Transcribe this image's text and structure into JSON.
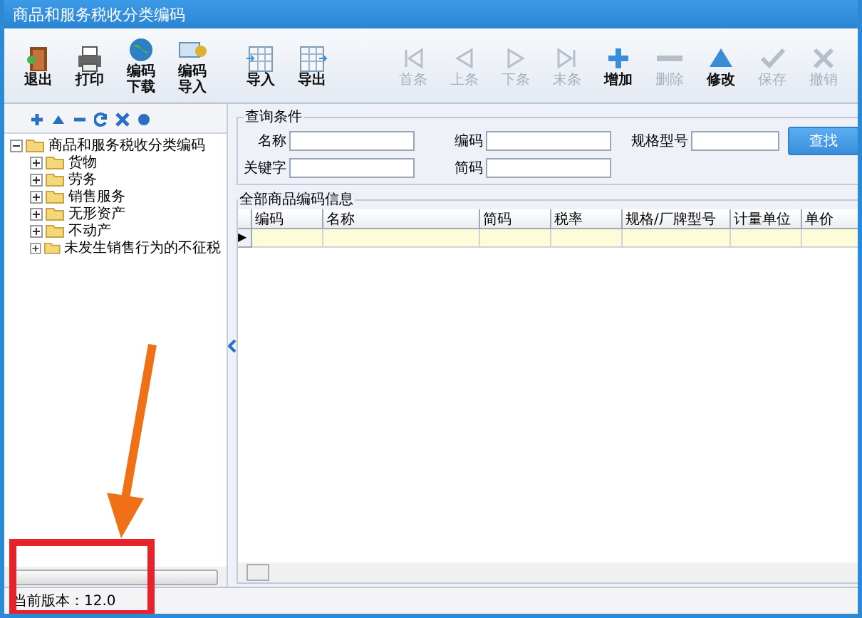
{
  "window": {
    "title": "商品和服务税收分类编码"
  },
  "toolbar_left": [
    {
      "label": "退出",
      "kind": "exit"
    },
    {
      "label": "打印",
      "kind": "print"
    },
    {
      "label": "编码下载",
      "kind": "download"
    },
    {
      "label": "编码导入",
      "kind": "import-code"
    },
    {
      "label": "导入",
      "kind": "import"
    },
    {
      "label": "导出",
      "kind": "export"
    }
  ],
  "toolbar_right": [
    {
      "label": "首条",
      "kind": "first",
      "disabled": true
    },
    {
      "label": "上条",
      "kind": "prev",
      "disabled": true
    },
    {
      "label": "下条",
      "kind": "next",
      "disabled": true
    },
    {
      "label": "末条",
      "kind": "last",
      "disabled": true
    },
    {
      "label": "增加",
      "kind": "add",
      "disabled": false
    },
    {
      "label": "删除",
      "kind": "delete",
      "disabled": true
    },
    {
      "label": "修改",
      "kind": "edit",
      "disabled": false
    },
    {
      "label": "保存",
      "kind": "save",
      "disabled": true
    },
    {
      "label": "撤销",
      "kind": "cancel",
      "disabled": true
    }
  ],
  "tree": {
    "label": "商品和服务税收分类编码",
    "expanded": true,
    "children": [
      {
        "label": "货物",
        "expanded": false
      },
      {
        "label": "劳务",
        "expanded": false
      },
      {
        "label": "销售服务",
        "expanded": false
      },
      {
        "label": "无形资产",
        "expanded": false
      },
      {
        "label": "不动产",
        "expanded": false
      },
      {
        "label": "未发生销售行为的不征税",
        "expanded": false
      }
    ]
  },
  "query": {
    "title": "查询条件",
    "fields": [
      {
        "label": "名称"
      },
      {
        "label": "编码"
      },
      {
        "label": "规格型号"
      },
      {
        "label": "关键字"
      },
      {
        "label": "简码"
      }
    ],
    "button": "查找"
  },
  "table": {
    "title": "全部商品编码信息",
    "columns": [
      "编码",
      "名称",
      "简码",
      "税率",
      "规格/厂牌型号",
      "计量单位",
      "单价"
    ],
    "rows": [
      {
        "marker": "▶",
        "selected": true
      }
    ]
  },
  "status_bar": "当前版本：12.0"
}
